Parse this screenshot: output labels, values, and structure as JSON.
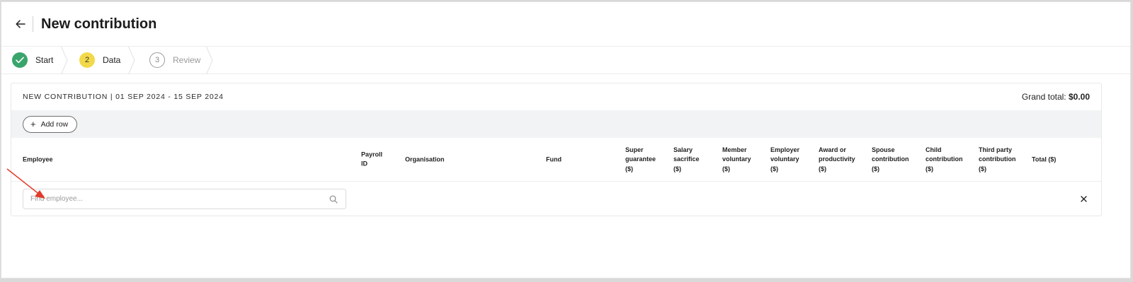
{
  "header": {
    "title": "New contribution",
    "back_icon": "arrow-left-icon"
  },
  "steps": [
    {
      "number": "",
      "label": "Start",
      "status": "done",
      "icon": "check-icon"
    },
    {
      "number": "2",
      "label": "Data",
      "status": "current"
    },
    {
      "number": "3",
      "label": "Review",
      "status": "todo"
    }
  ],
  "card": {
    "title": "NEW CONTRIBUTION | 01 SEP 2024 - 15 SEP 2024",
    "grand_total_label": "Grand total:",
    "grand_total_value": "$0.00",
    "add_row_label": "Add row"
  },
  "table": {
    "columns": [
      {
        "lines": [
          "Employee"
        ]
      },
      {
        "lines": [
          "Payroll",
          "ID"
        ]
      },
      {
        "lines": [
          "Organisation"
        ]
      },
      {
        "lines": [
          "Fund"
        ]
      },
      {
        "lines": [
          "Super",
          "guarantee",
          "($)"
        ]
      },
      {
        "lines": [
          "Salary",
          "sacrifice",
          "($)"
        ]
      },
      {
        "lines": [
          "Member",
          "voluntary",
          "($)"
        ]
      },
      {
        "lines": [
          "Employer",
          "voluntary",
          "($)"
        ]
      },
      {
        "lines": [
          "Award or",
          "productivity",
          "($)"
        ]
      },
      {
        "lines": [
          "Spouse",
          "contribution",
          "($)"
        ]
      },
      {
        "lines": [
          "Child",
          "contribution",
          "($)"
        ]
      },
      {
        "lines": [
          "Third party",
          "contribution",
          "($)"
        ]
      },
      {
        "lines": [
          "Total ($)"
        ]
      }
    ],
    "find_placeholder": "Find employee..."
  },
  "colors": {
    "success": "#3aa56b",
    "current": "#f2d94a",
    "annotation": "#e23b2a"
  }
}
